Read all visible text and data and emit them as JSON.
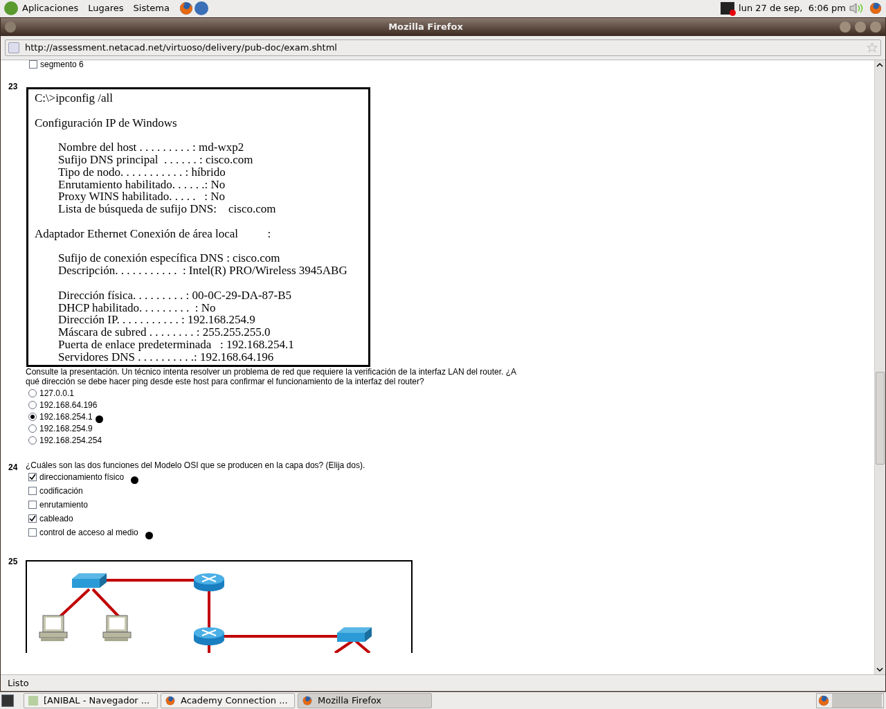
{
  "top_panel": {
    "menus": [
      "Aplicaciones",
      "Lugares",
      "Sistema"
    ],
    "clock": "lun 27 de sep,  6:06 pm"
  },
  "window": {
    "title": "Mozilla Firefox"
  },
  "address_bar": {
    "value": "http://assessment.netacad.net/virtuoso/delivery/pub-doc/exam.shtml"
  },
  "previous_option": {
    "label": "segmento 6",
    "checked": false
  },
  "questions": [
    {
      "number": "23",
      "kind": "radio",
      "exhibit": {
        "sections": [
          {
            "kind": "heading",
            "lines": [
              "C:\\>ipconfig /all"
            ]
          },
          {
            "kind": "heading",
            "lines": [
              "Configuración IP de Windows"
            ]
          },
          {
            "kind": "detail",
            "lines": [
              "Nombre del host . . . . . . . . . : md-wxp2",
              "Sufijo DNS principal  . . . . . . : cisco.com",
              "Tipo de nodo. . . . . . . . . . . : híbrido",
              "Enrutamiento habilitado. . . . . .: No",
              "Proxy WINS habilitado. . . . .   : No",
              "Lista de búsqueda de sufijo DNS:    cisco.com"
            ]
          },
          {
            "kind": "heading",
            "lines": [
              "Adaptador Ethernet Conexión de área local          :"
            ]
          },
          {
            "kind": "detail",
            "lines": [
              "Sufijo de conexión específica DNS : cisco.com",
              "Descripción. . . . . . . . . . .  : Intel(R) PRO/Wireless 3945ABG"
            ]
          },
          {
            "kind": "detail",
            "lines": [
              "Dirección física. . . . . . . . . : 00-0C-29-DA-87-B5",
              "DHCP habilitado. . . . . . . . .  : No",
              "Dirección IP. . . . . . . . . . . : 192.168.254.9",
              "Máscara de subred . . . . . . . . : 255.255.255.0",
              "Puerta de enlace predeterminada   : 192.168.254.1",
              "Servidores DNS . . . . . . . . . .: 192.168.64.196"
            ]
          }
        ]
      },
      "prompt": "Consulte la presentación. Un técnico intenta resolver un problema de red que requiere la verificación de la interfaz LAN del router. ¿A qué dirección se debe hacer ping desde este host para confirmar el funcionamiento de la interfaz del router?",
      "options": [
        {
          "label": "127.0.0.1",
          "selected": false,
          "marked": false
        },
        {
          "label": "192.168.64.196",
          "selected": false,
          "marked": false
        },
        {
          "label": "192.168.254.1",
          "selected": true,
          "marked": true
        },
        {
          "label": "192.168.254.9",
          "selected": false,
          "marked": false
        },
        {
          "label": "192.168.254.254",
          "selected": false,
          "marked": false
        }
      ]
    },
    {
      "number": "24",
      "kind": "checkbox",
      "prompt": "¿Cuáles son las dos funciones del Modelo OSI que se producen en la capa dos? (Elija dos).",
      "options": [
        {
          "label": "direccionamiento físico",
          "checked": true,
          "marked": true
        },
        {
          "label": "codificación",
          "checked": false,
          "marked": false
        },
        {
          "label": "enrutamiento",
          "checked": false,
          "marked": false
        },
        {
          "label": "cableado",
          "checked": true,
          "marked": false
        },
        {
          "label": "control de acceso al medio",
          "checked": false,
          "marked": true
        }
      ]
    },
    {
      "number": "25",
      "kind": "diagram"
    }
  ],
  "status_bar": {
    "text": "Listo"
  },
  "taskbar": [
    {
      "label": "[ANIBAL - Navegador ...",
      "selected": false
    },
    {
      "label": "Academy Connection ...",
      "selected": false
    },
    {
      "label": "Mozilla Firefox",
      "selected": true
    }
  ]
}
